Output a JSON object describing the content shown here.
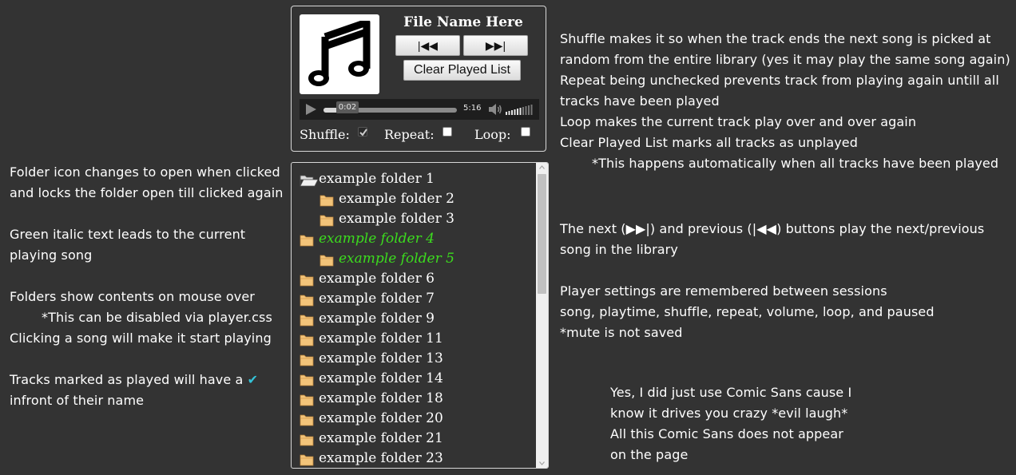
{
  "player": {
    "file_name": "File Name Here",
    "prev_label": "|◀◀",
    "next_label": "▶▶|",
    "clear_label": "Clear Played List",
    "current_time": "0:02",
    "duration": "5:16",
    "progress_fraction": 0.22,
    "volume_level_bars": 6,
    "volume_total_bars": 10,
    "options": {
      "shuffle_label": "Shuffle:",
      "shuffle_checked": true,
      "repeat_label": "Repeat:",
      "repeat_checked": false,
      "loop_label": "Loop:",
      "loop_checked": false
    }
  },
  "library": {
    "folders": [
      {
        "name": "example folder 1",
        "level": 0,
        "open": true,
        "playing": false
      },
      {
        "name": "example folder 2",
        "level": 1,
        "open": false,
        "playing": false
      },
      {
        "name": "example folder 3",
        "level": 1,
        "open": false,
        "playing": false
      },
      {
        "name": "example folder 4",
        "level": 0,
        "open": false,
        "playing": true
      },
      {
        "name": "example folder 5",
        "level": 1,
        "open": false,
        "playing": true
      },
      {
        "name": "example folder 6",
        "level": 0,
        "open": false,
        "playing": false
      },
      {
        "name": "example folder 7",
        "level": 0,
        "open": false,
        "playing": false
      },
      {
        "name": "example folder 9",
        "level": 0,
        "open": false,
        "playing": false
      },
      {
        "name": "example folder 11",
        "level": 0,
        "open": false,
        "playing": false
      },
      {
        "name": "example folder 13",
        "level": 0,
        "open": false,
        "playing": false
      },
      {
        "name": "example folder 14",
        "level": 0,
        "open": false,
        "playing": false
      },
      {
        "name": "example folder 18",
        "level": 0,
        "open": false,
        "playing": false
      },
      {
        "name": "example folder 20",
        "level": 0,
        "open": false,
        "playing": false
      },
      {
        "name": "example folder 21",
        "level": 0,
        "open": false,
        "playing": false
      },
      {
        "name": "example folder 23",
        "level": 0,
        "open": false,
        "playing": false
      }
    ]
  },
  "notes": {
    "left": {
      "l1": "Folder icon changes to open when clicked",
      "l2": "and locks the folder open till clicked again",
      "l3": "Green italic text leads to the current",
      "l4": "playing song",
      "l5": "Folders show contents on mouse over",
      "l6": "*This can be disabled via player.css",
      "l7": "Clicking a song will make it start playing",
      "l8": "Tracks marked as played will have a",
      "l8_check": "✔",
      "l9": "infront of their name"
    },
    "right": {
      "r1": "Shuffle makes it so when the track ends the next song is picked at",
      "r2": "random from the entire library (yes it may play the same song again)",
      "r3": "Repeat being unchecked prevents track from playing again untill all",
      "r4": "tracks have been played",
      "r5": "Loop makes the current track play over and over again",
      "r6": "Clear Played List marks all tracks as unplayed",
      "r7": "*This happens automatically when all tracks have been played",
      "r8": "The next (▶▶|) and previous (|◀◀) buttons play the next/previous",
      "r9": "song in the library",
      "r10": "Player settings are remembered between sessions",
      "r11": "song, playtime, shuffle, repeat, volume, loop, and paused",
      "r12": "*mute is not saved"
    },
    "comic": {
      "c1": "Yes, I did just use Comic Sans cause I",
      "c2": "know it drives you crazy *evil laugh*",
      "c3": "All this Comic Sans does not appear",
      "c4": "on the page"
    }
  },
  "colors": {
    "background": "#333333",
    "playing_text": "#3cdc1e",
    "played_check": "#34c3d8",
    "folder_icon": "#f3c47a"
  }
}
